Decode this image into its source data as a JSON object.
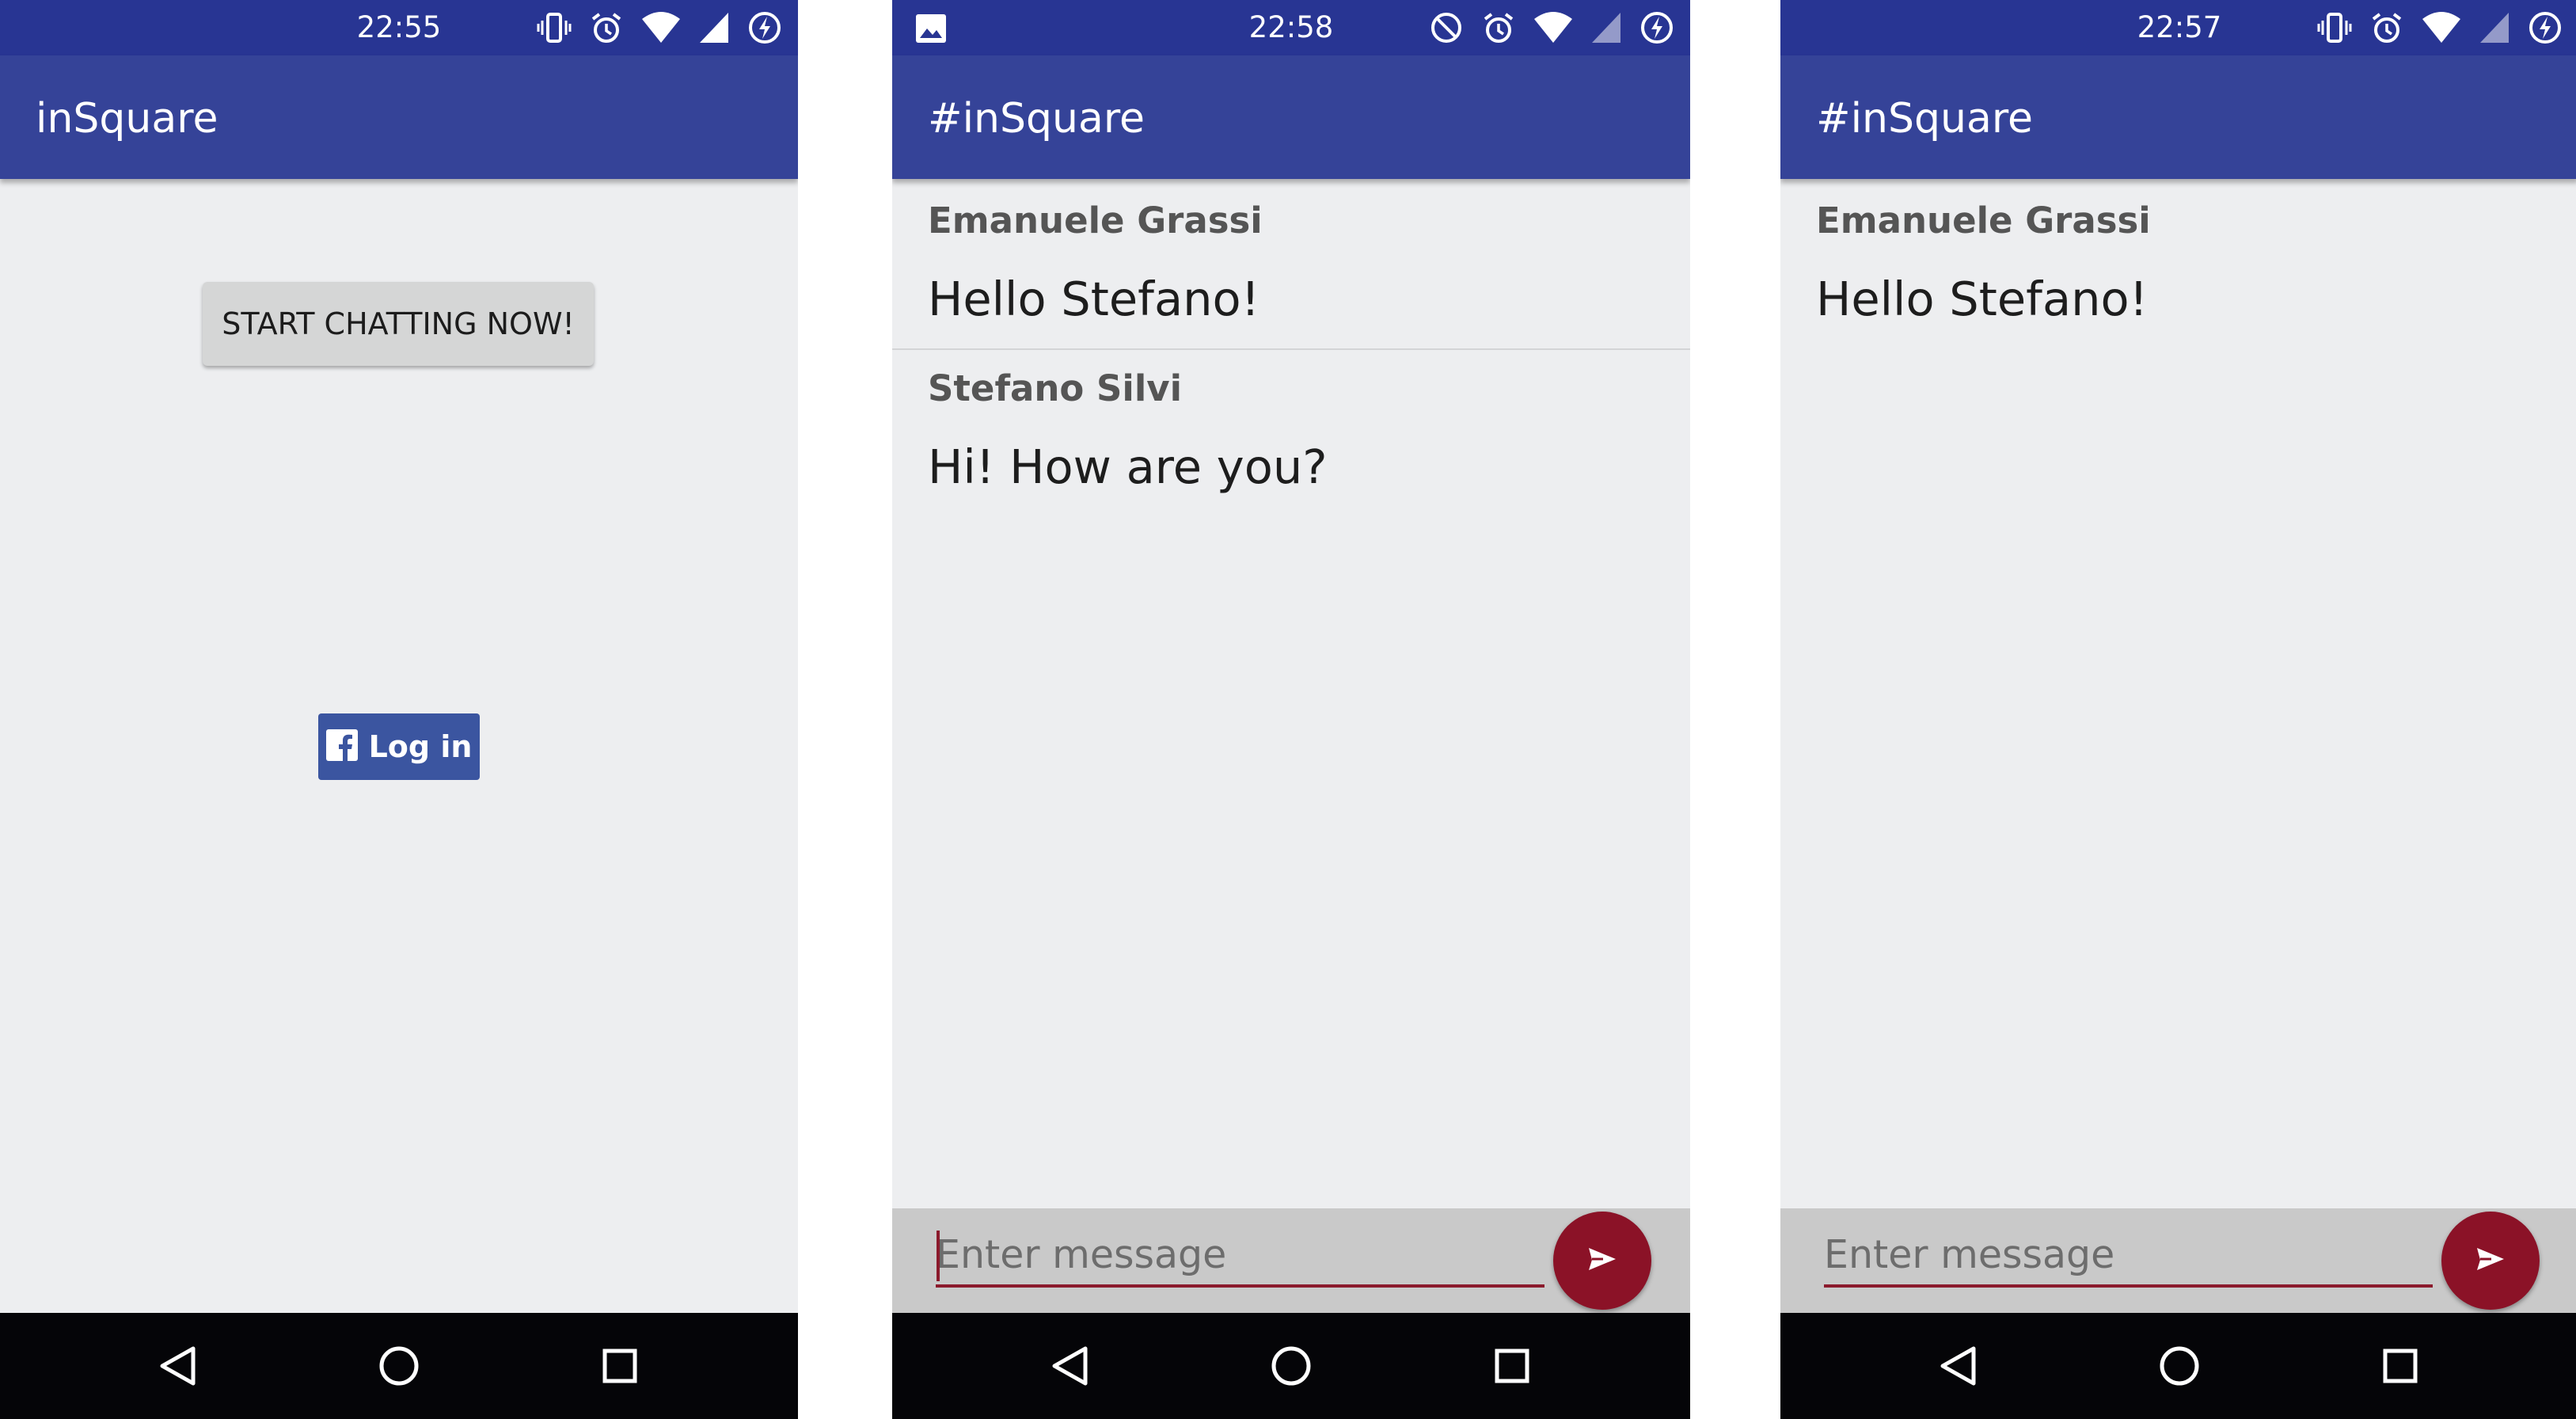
{
  "colors": {
    "status_bar": "#283593",
    "app_bar": "#354398",
    "background": "#edeef0",
    "accent": "#8b1227",
    "facebook": "#3b55a0",
    "nav_bar": "#050508"
  },
  "screens": [
    {
      "status": {
        "time": "22:55",
        "icons": [
          "vibrate-icon",
          "alarm-icon",
          "wifi-icon",
          "signal-icon",
          "battery-saver-icon"
        ]
      },
      "app_bar": {
        "title": "inSquare"
      },
      "start_button": {
        "label": "START CHATTING NOW!"
      },
      "facebook_login": {
        "label": "Log in",
        "icon": "facebook-icon"
      }
    },
    {
      "status": {
        "time": "22:58",
        "icons": [
          "image-icon",
          "do-not-disturb-icon",
          "alarm-icon",
          "wifi-icon",
          "signal-icon",
          "battery-saver-icon"
        ]
      },
      "app_bar": {
        "title": "#inSquare"
      },
      "messages": [
        {
          "author": "Emanuele Grassi",
          "text": "Hello Stefano!"
        },
        {
          "author": "Stefano Silvi",
          "text": "Hi! How are you?"
        }
      ],
      "composer": {
        "placeholder": "Enter message",
        "value": "",
        "send_icon": "send-icon"
      }
    },
    {
      "status": {
        "time": "22:57",
        "icons": [
          "vibrate-icon",
          "alarm-icon",
          "wifi-icon",
          "signal-icon",
          "battery-saver-icon"
        ]
      },
      "app_bar": {
        "title": "#inSquare"
      },
      "messages": [
        {
          "author": "Emanuele Grassi",
          "text": "Hello Stefano!"
        }
      ],
      "composer": {
        "placeholder": "Enter message",
        "value": "",
        "send_icon": "send-icon"
      }
    }
  ],
  "nav_bar": {
    "buttons": [
      "back-icon",
      "home-icon",
      "recents-icon"
    ]
  }
}
